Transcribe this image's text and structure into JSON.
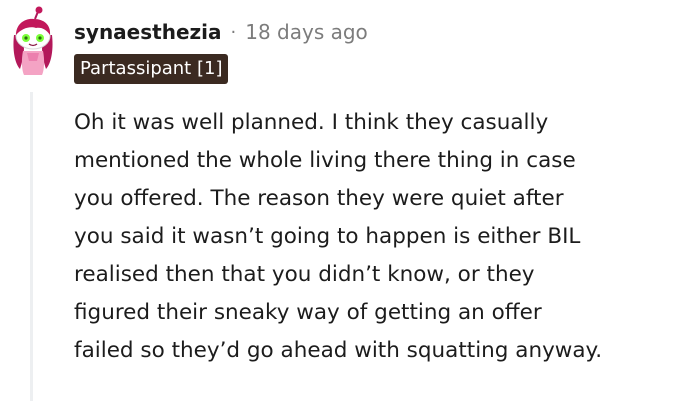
{
  "comment": {
    "author": "synaesthezia",
    "separator": "·",
    "timestamp": "18 days ago",
    "flair": "Partassipant [1]",
    "avatar_icon": "snoo-avatar-icon",
    "body_lines": [
      "Oh it was well planned. I think they casually",
      "mentioned the whole living there thing in case",
      "you offered. The reason they were quiet after",
      "you said it wasn’t going to happen is either BIL",
      "realised then that you didn’t know, or they",
      "figured their sneaky way of getting an offer",
      "failed so they’d go ahead with squatting anyway."
    ]
  },
  "colors": {
    "flair_background": "#3b2a21",
    "flair_text": "#ffffff",
    "timestamp": "#7c7c7c",
    "thread_line": "#edeff1",
    "text": "#1c1c1c",
    "avatar_hair": "#c2185b",
    "avatar_eyes": "#7cff3a"
  }
}
